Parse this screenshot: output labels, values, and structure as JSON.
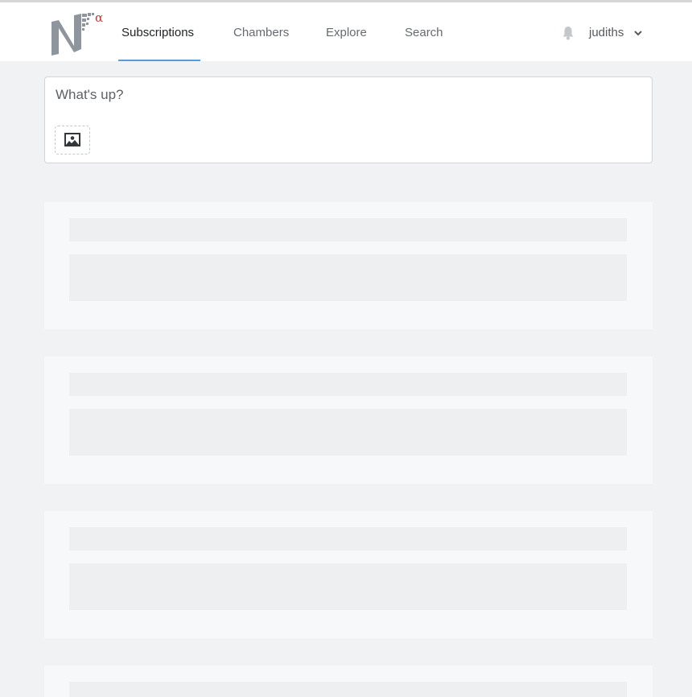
{
  "header": {
    "logo_alt": "Nα",
    "tabs": [
      {
        "label": "Subscriptions",
        "active": true
      },
      {
        "label": "Chambers",
        "active": false
      },
      {
        "label": "Explore",
        "active": false
      },
      {
        "label": "Search",
        "active": false
      }
    ],
    "user": {
      "name": "judiths"
    },
    "icons": {
      "notifications": "bell-icon",
      "user_menu": "chevron-down-icon"
    }
  },
  "composer": {
    "placeholder": "What's up?",
    "attach_icon": "image-icon"
  },
  "feed": {
    "loading_placeholders": 4
  },
  "colors": {
    "background": "#f1f2f4",
    "active_tab_underline": "#5b9bd8",
    "logo_gray": "#8e959c",
    "logo_alpha": "#c0392b"
  }
}
